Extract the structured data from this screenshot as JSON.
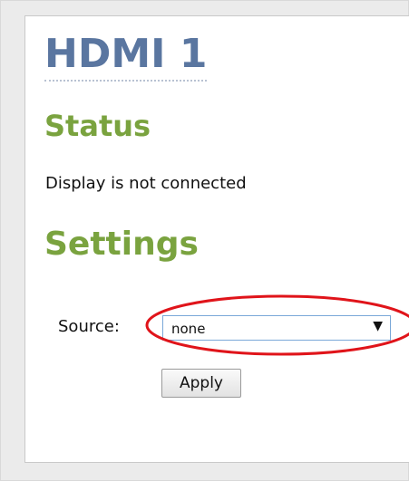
{
  "page": {
    "title": "HDMI 1"
  },
  "status": {
    "heading": "Status",
    "text": "Display is not connected"
  },
  "settings": {
    "heading": "Settings",
    "source_label": "Source:",
    "source_value": "none",
    "apply_label": "Apply"
  },
  "icons": {
    "dropdown_arrow": "▼"
  },
  "colors": {
    "title": "#5a76a0",
    "section_heading": "#7aa33f",
    "highlight": "#e0141a"
  }
}
